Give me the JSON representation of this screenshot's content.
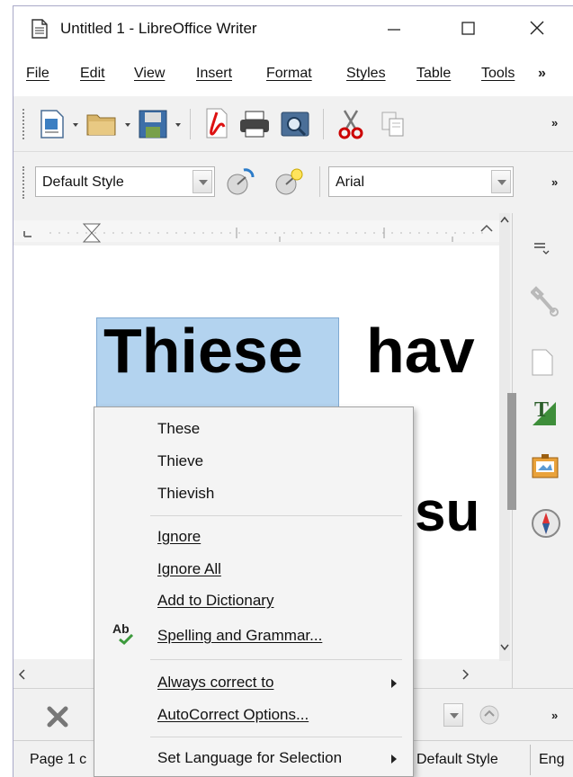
{
  "window": {
    "title": "Untitled 1 - LibreOffice Writer",
    "minimize_glyph": "—",
    "maximize_glyph": "☐",
    "close_glyph": "✕"
  },
  "menubar": {
    "items": [
      "File",
      "Edit",
      "View",
      "Insert",
      "Format",
      "Styles",
      "Table",
      "Tools"
    ],
    "overflow": "»"
  },
  "toolbar": {
    "overflow": "»",
    "paragraph_style": "Default Style",
    "font_name": "Arial"
  },
  "document": {
    "line1_selected": "Thiese",
    "line1_rest": "hav",
    "line2_fragment": "su",
    "selection_color": "#b3d3ef",
    "misspelling_color": "#e02020"
  },
  "context_menu": {
    "suggestions": [
      "These",
      "Thieve",
      "Thievish"
    ],
    "ignore": "Ignore",
    "ignore_all": "Ignore All",
    "add_to_dictionary": "Add to Dictionary",
    "spelling_and_grammar": "Spelling and Grammar...",
    "always_correct_to": "Always correct to",
    "autocorrect_options": "AutoCorrect Options...",
    "set_language_selection": "Set Language for Selection",
    "spelling_icon_label": "Ab"
  },
  "statusbar": {
    "page_info": "Page 1 c",
    "page_style": "Default Style",
    "language": "Eng"
  },
  "bottom_toolbar": {
    "overflow": "»"
  }
}
